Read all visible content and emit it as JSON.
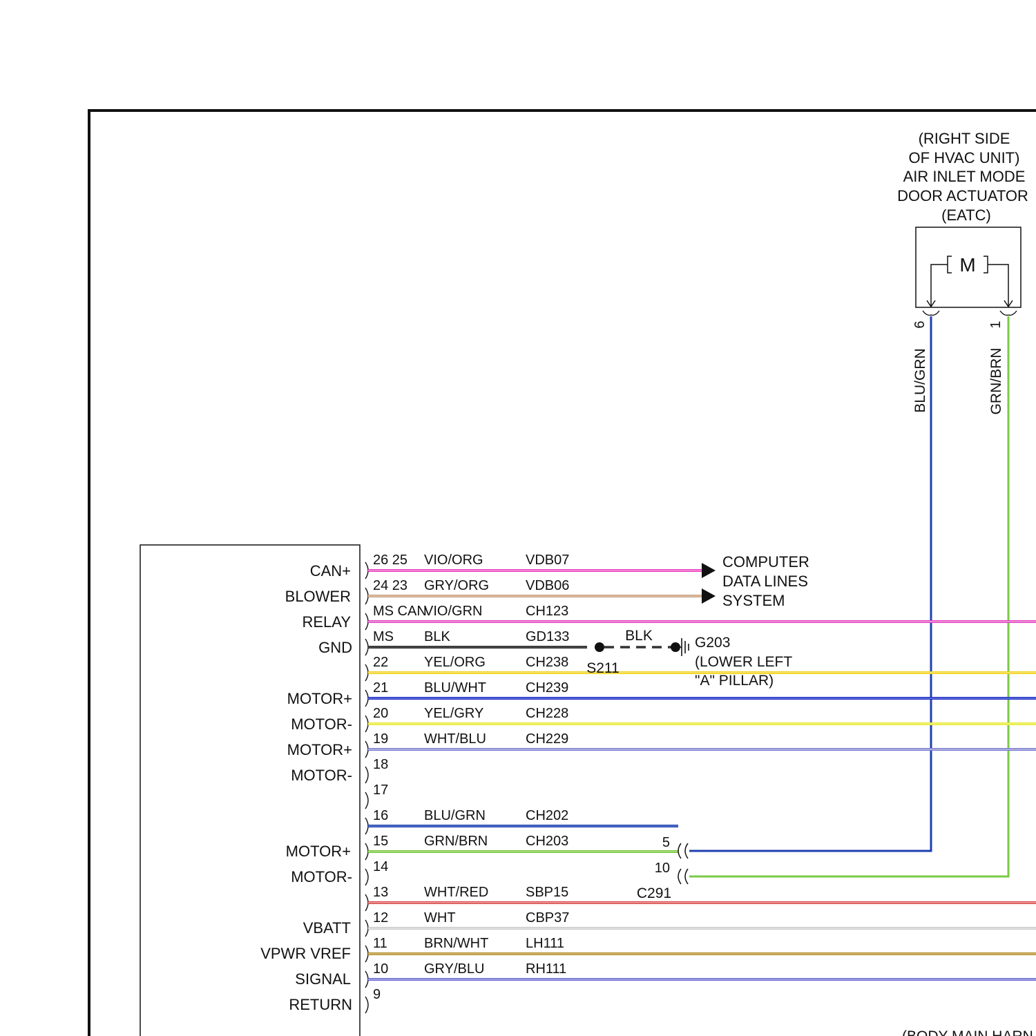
{
  "actuator": {
    "title_lines": [
      "(RIGHT SIDE",
      "OF HVAC UNIT)",
      "AIR INLET MODE",
      "DOOR ACTUATOR",
      "(EATC)"
    ],
    "motor_label": "M",
    "pins": [
      {
        "pin": "6",
        "wire_color": "BLU/GRN",
        "stroke": "#1f3fae"
      },
      {
        "pin": "1",
        "wire_color": "GRN/BRN",
        "stroke": "#7ac943"
      }
    ]
  },
  "module": {
    "labels": [
      "CAN+",
      "BLOWER",
      "RELAY",
      "GND",
      "MOTOR+",
      "MOTOR-",
      "MOTOR+",
      "MOTOR-",
      "MOTOR+",
      "MOTOR-",
      "VBATT",
      "VPWR VREF",
      "SIGNAL",
      "RETURN"
    ]
  },
  "circuits": [
    {
      "pins": "26 25",
      "color": "VIO/ORG",
      "circuit": "VDB07",
      "stroke": "#e83fbf",
      "inner": "#f7a9e0"
    },
    {
      "pins": "24 23",
      "color": "GRY/ORG",
      "circuit": "VDB06",
      "stroke": "#c8a080",
      "inner": "#e8cdb8"
    },
    {
      "pins": "MS CAN",
      "color": "VIO/GRN",
      "circuit": "CH123",
      "stroke": "#e040c0",
      "inner": "#f6b3e4"
    },
    {
      "pins": "MS",
      "color": "BLK",
      "circuit": "GD133",
      "stroke": "#333333",
      "inner": "#555555"
    },
    {
      "pins": "22",
      "color": "YEL/ORG",
      "circuit": "CH238",
      "stroke": "#f2d21c",
      "inner": "#f7e98a"
    },
    {
      "pins": "21",
      "color": "BLU/WHT",
      "circuit": "CH239",
      "stroke": "#1f2fc8",
      "inner": "#7c86e0"
    },
    {
      "pins": "20",
      "color": "YEL/GRY",
      "circuit": "CH228",
      "stroke": "#e8ea30",
      "inner": "#f4f59a"
    },
    {
      "pins": "19",
      "color": "WHT/BLU",
      "circuit": "CH229",
      "stroke": "#7a7acc",
      "inner": "#c7c7ee"
    },
    {
      "pins": "18",
      "color": "",
      "circuit": ""
    },
    {
      "pins": "17",
      "color": "",
      "circuit": ""
    },
    {
      "pins": "16",
      "color": "BLU/GRN",
      "circuit": "CH202",
      "stroke": "#1f3fae",
      "inner": "#6f8ed8"
    },
    {
      "pins": "15",
      "color": "GRN/BRN",
      "circuit": "CH203",
      "stroke": "#7ac943",
      "inner": "#b7e28e"
    },
    {
      "pins": "14",
      "color": "",
      "circuit": ""
    },
    {
      "pins": "13",
      "color": "WHT/RED",
      "circuit": "SBP15",
      "stroke": "#d94040",
      "inner": "#f3c0c0"
    },
    {
      "pins": "12",
      "color": "WHT",
      "circuit": "CBP37",
      "stroke": "#c8c8c8",
      "inner": "#eeeeee"
    },
    {
      "pins": "11",
      "color": "BRN/WHT",
      "circuit": "LH111",
      "stroke": "#b08a2a",
      "inner": "#e2cf8f"
    },
    {
      "pins": "10",
      "color": "GRY/BLU",
      "circuit": "RH111",
      "stroke": "#6a6ad0",
      "inner": "#b9b9ee"
    },
    {
      "pins": "9",
      "color": "",
      "circuit": ""
    }
  ],
  "data_lines": {
    "lines": [
      "COMPUTER",
      "DATA LINES",
      "SYSTEM"
    ]
  },
  "ground": {
    "splice": "S211",
    "wire_color": "BLK",
    "ground_id": "G203",
    "location_lines": [
      "(LOWER LEFT",
      "\"A\" PILLAR)"
    ]
  },
  "inline_connector": {
    "name": "C291",
    "pins": [
      "5",
      "10"
    ]
  },
  "harness_label": "(BODY MAIN HARN"
}
